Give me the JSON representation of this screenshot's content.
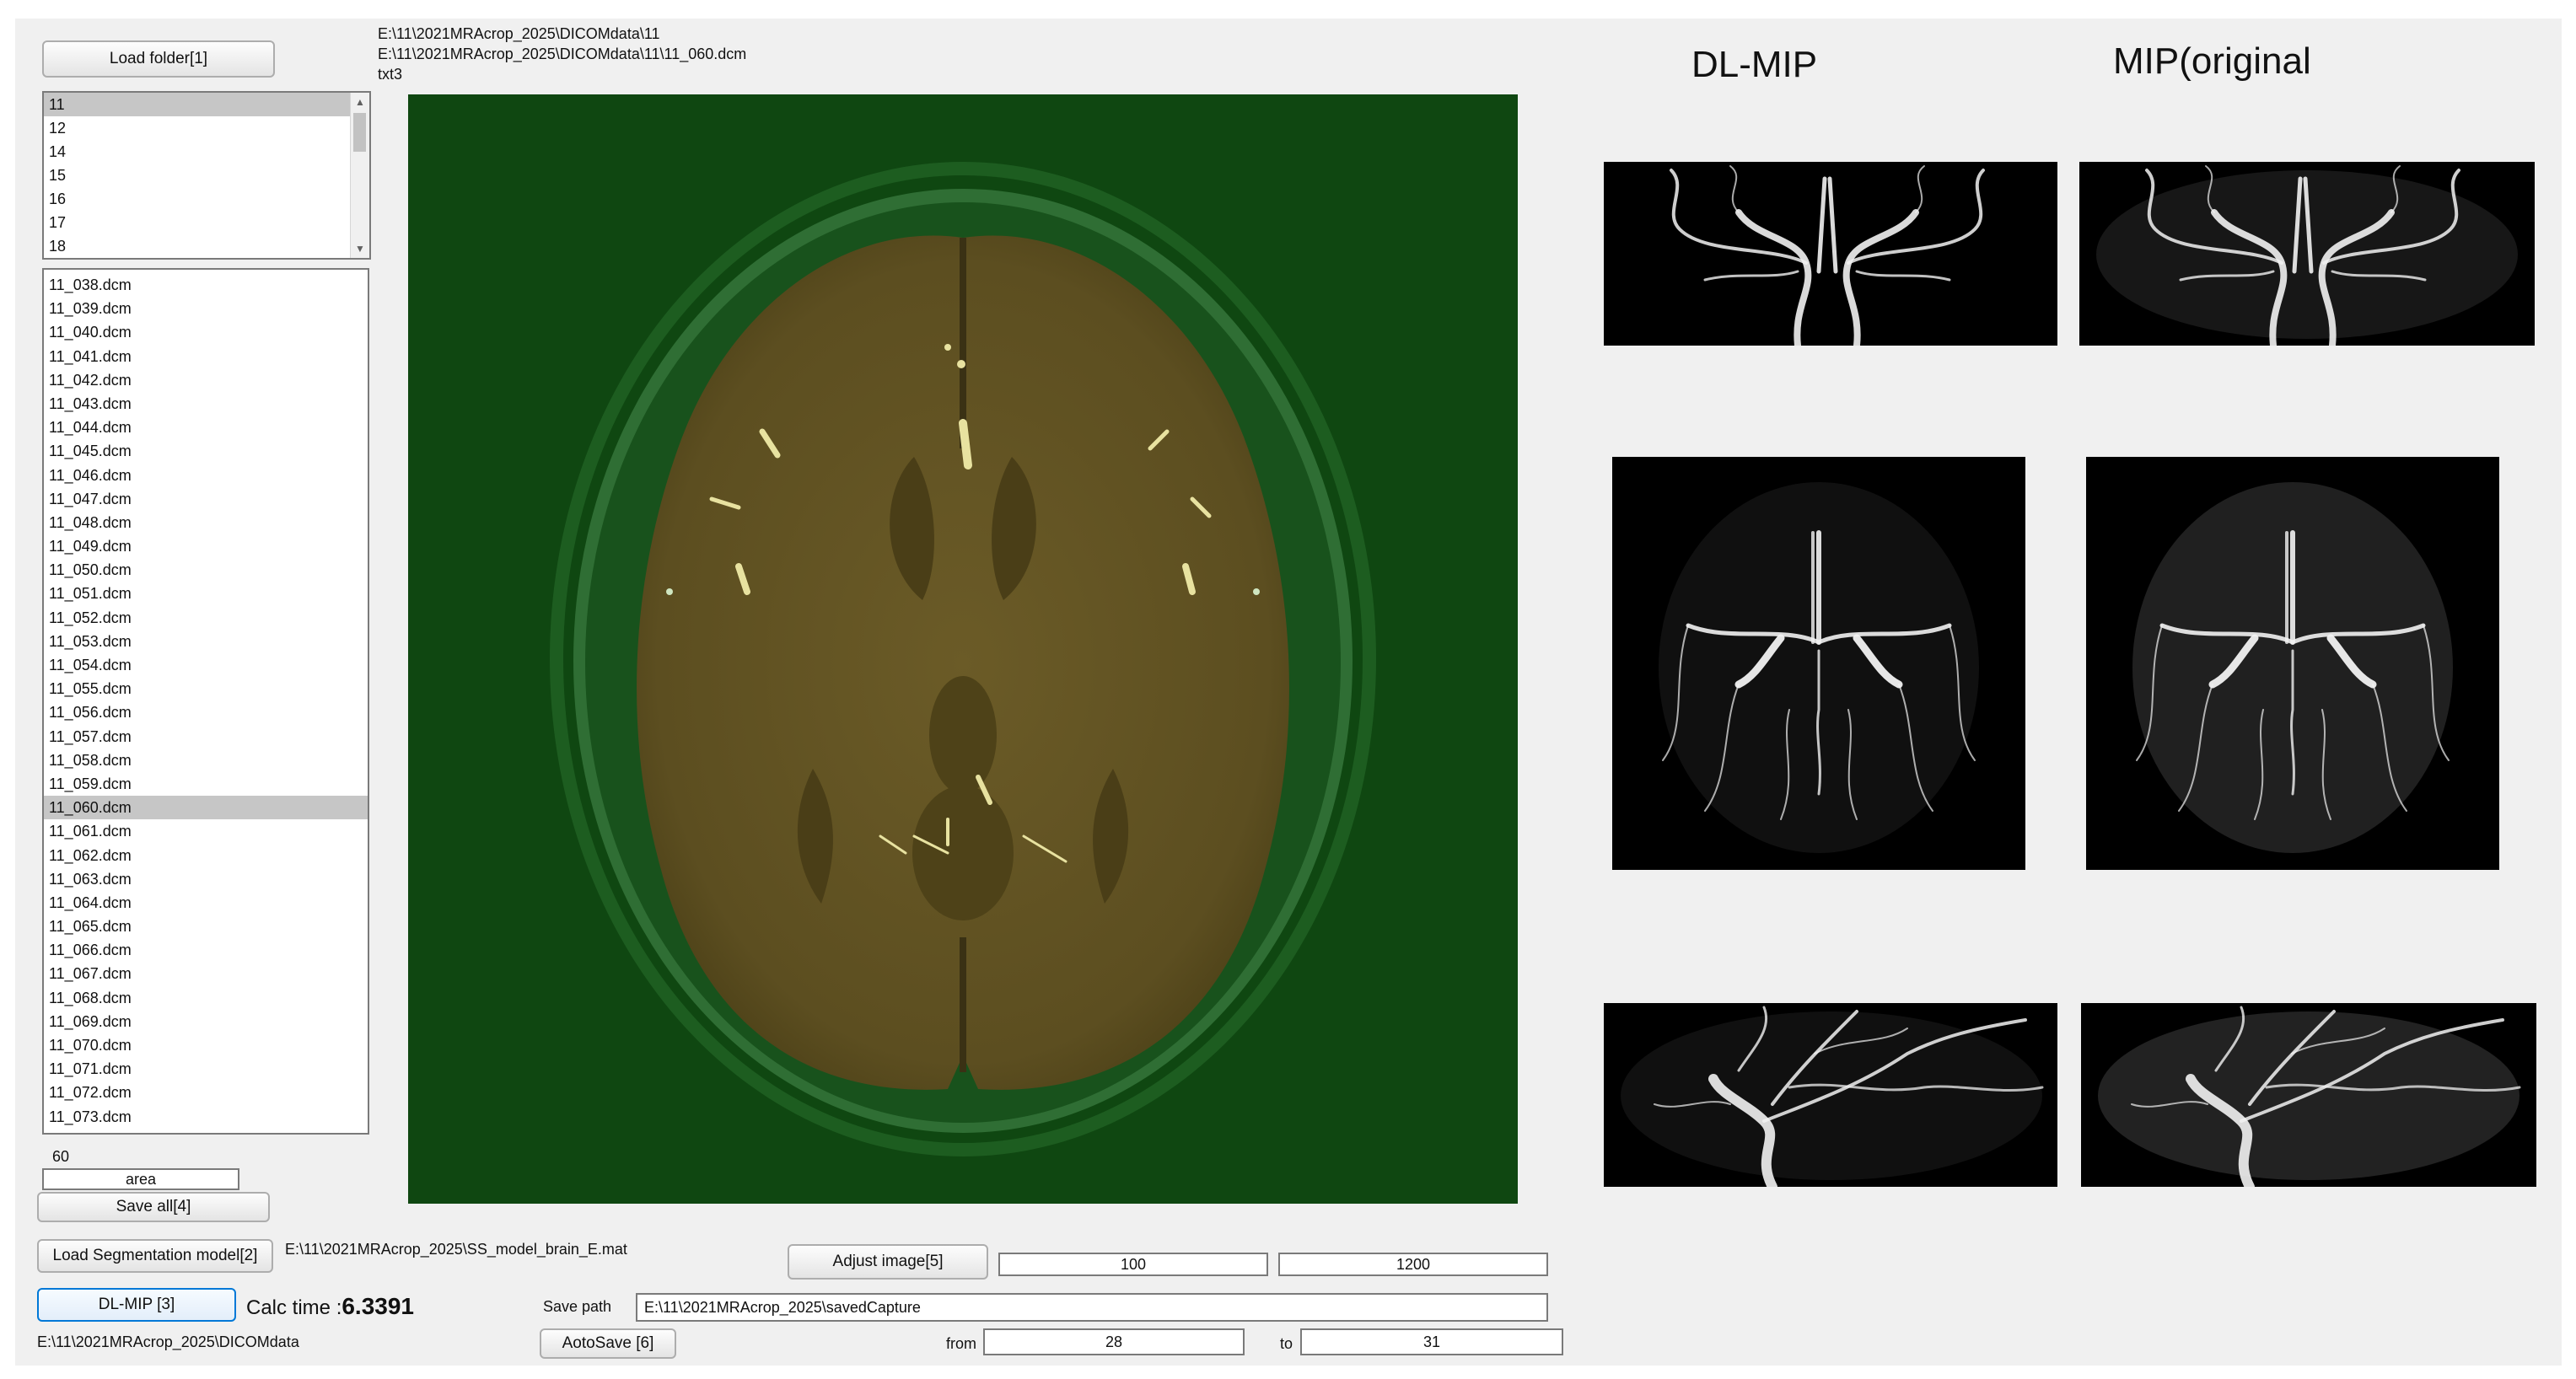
{
  "paths": {
    "folder_line": "E:\\11\\2021MRAcrop_2025\\DICOMdata\\11",
    "file_line": "E:\\11\\2021MRAcrop_2025\\DICOMdata\\11\\11_060.dcm",
    "tag_line": "txt3",
    "model_path": "E:\\11\\2021MRAcrop_2025\\SS_model_brain_E.mat",
    "data_root": "E:\\11\\2021MRAcrop_2025\\DICOMdata"
  },
  "buttons": {
    "load_folder": "Load folder[1]",
    "save_all": "Save all[4]",
    "load_model": "Load Segmentation model[2]",
    "dl_mip": "DL-MIP [3]",
    "adjust_image": "Adjust image[5]",
    "autosave": "AotoSave [6]"
  },
  "folder_list": {
    "items": [
      "11",
      "12",
      "14",
      "15",
      "16",
      "17",
      "18"
    ],
    "selected": "11"
  },
  "file_list": {
    "items": [
      "11_038.dcm",
      "11_039.dcm",
      "11_040.dcm",
      "11_041.dcm",
      "11_042.dcm",
      "11_043.dcm",
      "11_044.dcm",
      "11_045.dcm",
      "11_046.dcm",
      "11_047.dcm",
      "11_048.dcm",
      "11_049.dcm",
      "11_050.dcm",
      "11_051.dcm",
      "11_052.dcm",
      "11_053.dcm",
      "11_054.dcm",
      "11_055.dcm",
      "11_056.dcm",
      "11_057.dcm",
      "11_058.dcm",
      "11_059.dcm",
      "11_060.dcm",
      "11_061.dcm",
      "11_062.dcm",
      "11_063.dcm",
      "11_064.dcm",
      "11_065.dcm",
      "11_066.dcm",
      "11_067.dcm",
      "11_068.dcm",
      "11_069.dcm",
      "11_070.dcm",
      "11_071.dcm",
      "11_072.dcm",
      "11_073.dcm"
    ],
    "selected": "11_060.dcm"
  },
  "slice_number": "60",
  "area_field": "area",
  "calc_time": {
    "label": "Calc time :",
    "value": "6.3391"
  },
  "window": {
    "min": "100",
    "max": "1200"
  },
  "save_path": {
    "label": "Save path",
    "value": "E:\\11\\2021MRAcrop_2025\\savedCapture"
  },
  "range": {
    "from_label": "from",
    "from": "28",
    "to_label": "to",
    "to": "31"
  },
  "headings": {
    "dl_mip": "DL-MIP",
    "mip_original": "MIP(original"
  },
  "colors": {
    "overlay_green": "#0f4711",
    "brain_overlay": "#5d4f20",
    "selected_row": "#c6c6c6",
    "active_border": "#0078d7"
  }
}
